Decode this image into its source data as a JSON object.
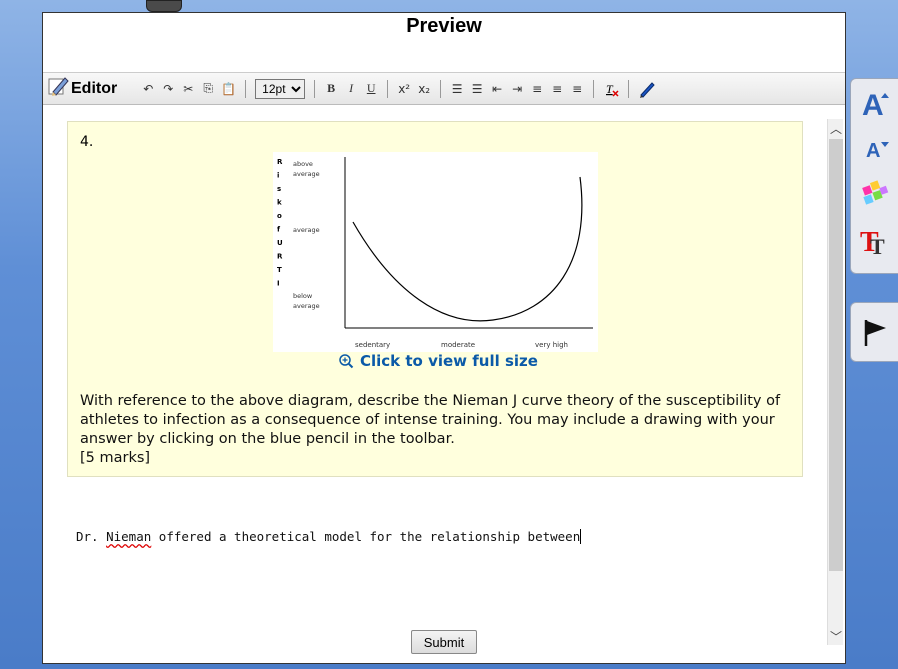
{
  "window": {
    "title": "Preview"
  },
  "toolbar": {
    "editor_label": "Editor",
    "font_size": "12pt",
    "font_size_options": [
      "12pt"
    ],
    "bold": "B",
    "italic": "I",
    "underline": "U",
    "superscript": "x²",
    "subscript": "x₂",
    "icons": [
      "undo-icon",
      "redo-icon",
      "cut-icon",
      "copy-icon",
      "paste-icon",
      "numbered-list-icon",
      "bullet-list-icon",
      "outdent-icon",
      "indent-icon",
      "align-left-icon",
      "align-center-icon",
      "align-right-icon",
      "clear-format-icon",
      "pencil-icon"
    ]
  },
  "question": {
    "number": "4.",
    "link_text": "Click to view full size",
    "text": "With reference to the above diagram, describe the Nieman J curve theory of the susceptibility of athletes to infection as a consequence of intense training. You may include a drawing with your answer by clicking on the blue pencil in the toolbar.",
    "marks": "[5 marks]"
  },
  "chart_data": {
    "type": "line",
    "title": "",
    "ylabel": "Risk of URTI",
    "ylabel_letters": [
      "R",
      "i",
      "s",
      "k",
      "o",
      "f",
      "U",
      "R",
      "T",
      "I"
    ],
    "y_ticks": [
      "above average",
      "average",
      "below average"
    ],
    "x_ticks": [
      "sedentary",
      "moderate",
      "very high"
    ],
    "curve": "J-shaped"
  },
  "answer": {
    "prefix": "Dr. ",
    "misspelled": "Nieman",
    "rest": " offered a theoretical model for the relationship between"
  },
  "submit_label": "Submit",
  "side_tools": [
    "increase-font-icon",
    "decrease-font-icon",
    "color-palette-icon",
    "text-style-icon",
    "flag-icon"
  ],
  "colors": {
    "link": "#0b5aa8",
    "question_bg": "#ffffdd",
    "accent": "#3a6fc4"
  }
}
